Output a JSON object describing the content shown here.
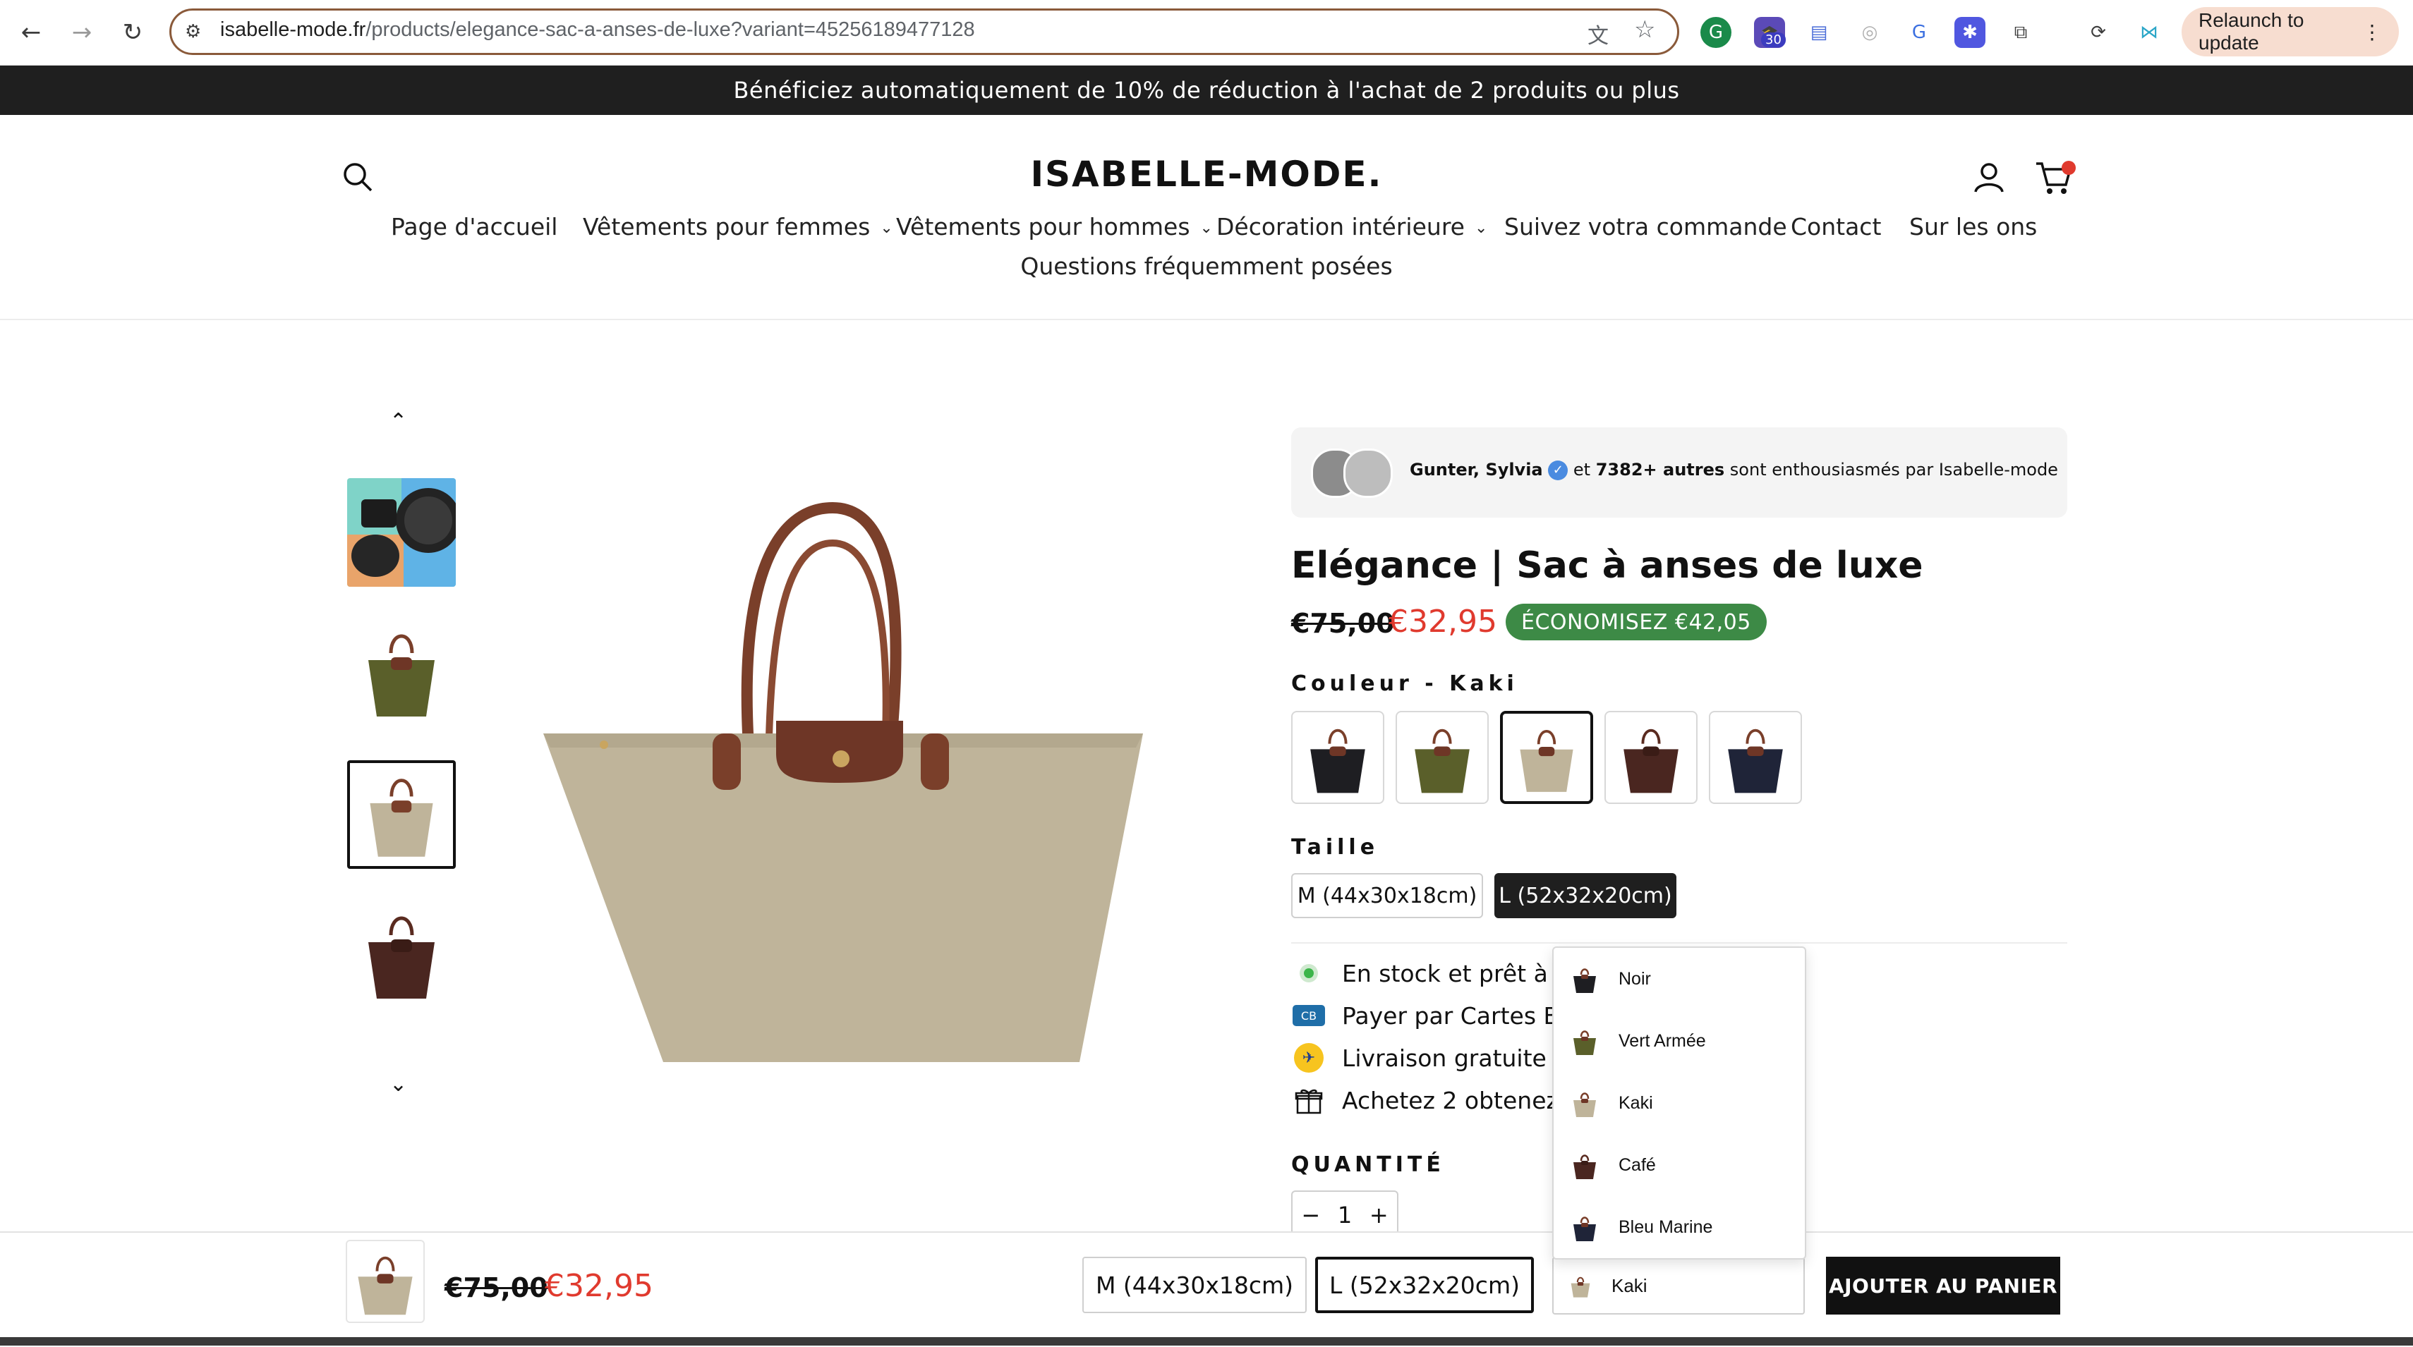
{
  "browser": {
    "url_host": "isabelle-mode.fr",
    "url_path": "/products/elegance-sac-a-anses-de-luxe?variant=45256189477128",
    "extension_badge": "30",
    "relaunch_label": "Relaunch to update"
  },
  "announcement": "Bénéficiez automatiquement de 10% de réduction à l'achat de 2 produits ou plus",
  "header": {
    "logo": "ISABELLE-MODE.",
    "menu": [
      "Page d'accueil",
      "Vêtements pour femmes",
      "Vêtements pour hommes",
      "Décoration intérieure",
      "Suivez votra commande",
      "Contact",
      "Sur les ons",
      "Questions fréquemment posées"
    ]
  },
  "social_proof": {
    "names": "Gunter, Sylvia",
    "and": "et",
    "count": "7382+ autres",
    "suffix": "sont enthousiasmés par Isabelle-mode"
  },
  "product": {
    "title": "Elégance | Sac à anses de luxe",
    "old_price": "€75,00",
    "price": "€32,95",
    "save_badge": "ÉCONOMISEZ €42,05",
    "color_label": "Couleur - Kaki",
    "colors": [
      {
        "name": "Noir",
        "hex": "#1e1e22"
      },
      {
        "name": "Vert Armée",
        "hex": "#5a5f2a"
      },
      {
        "name": "Kaki",
        "hex": "#bfb49a"
      },
      {
        "name": "Café",
        "hex": "#4a2620"
      },
      {
        "name": "Bleu Marine",
        "hex": "#1f2438"
      }
    ],
    "selected_color": "Kaki",
    "size_label": "Taille",
    "sizes": [
      "M (44x30x18cm)",
      "L (52x32x20cm)"
    ],
    "selected_size": "L (52x32x20cm)",
    "features": [
      "En stock et prêt à êtr",
      "Payer par Cartes Bar",
      "Livraison gratuite ave",
      "Achetez 2 obtenez 1"
    ],
    "quantity_label": "QUANTITÉ",
    "quantity": "1",
    "qty_minus": "−",
    "qty_plus": "+"
  },
  "sticky_bar": {
    "old_price": "€75,00",
    "price": "€32,95",
    "size_m": "M (44x30x18cm)",
    "size_l": "L (52x32x20cm)",
    "color_value": "Kaki",
    "add_to_cart": "AJOUTER AU PANIER"
  },
  "colors": {
    "accent_red": "#e03a2e",
    "badge_green": "#3d8a46",
    "bag_khaki": "#bfb49a",
    "leather": "#7a3f2a"
  }
}
